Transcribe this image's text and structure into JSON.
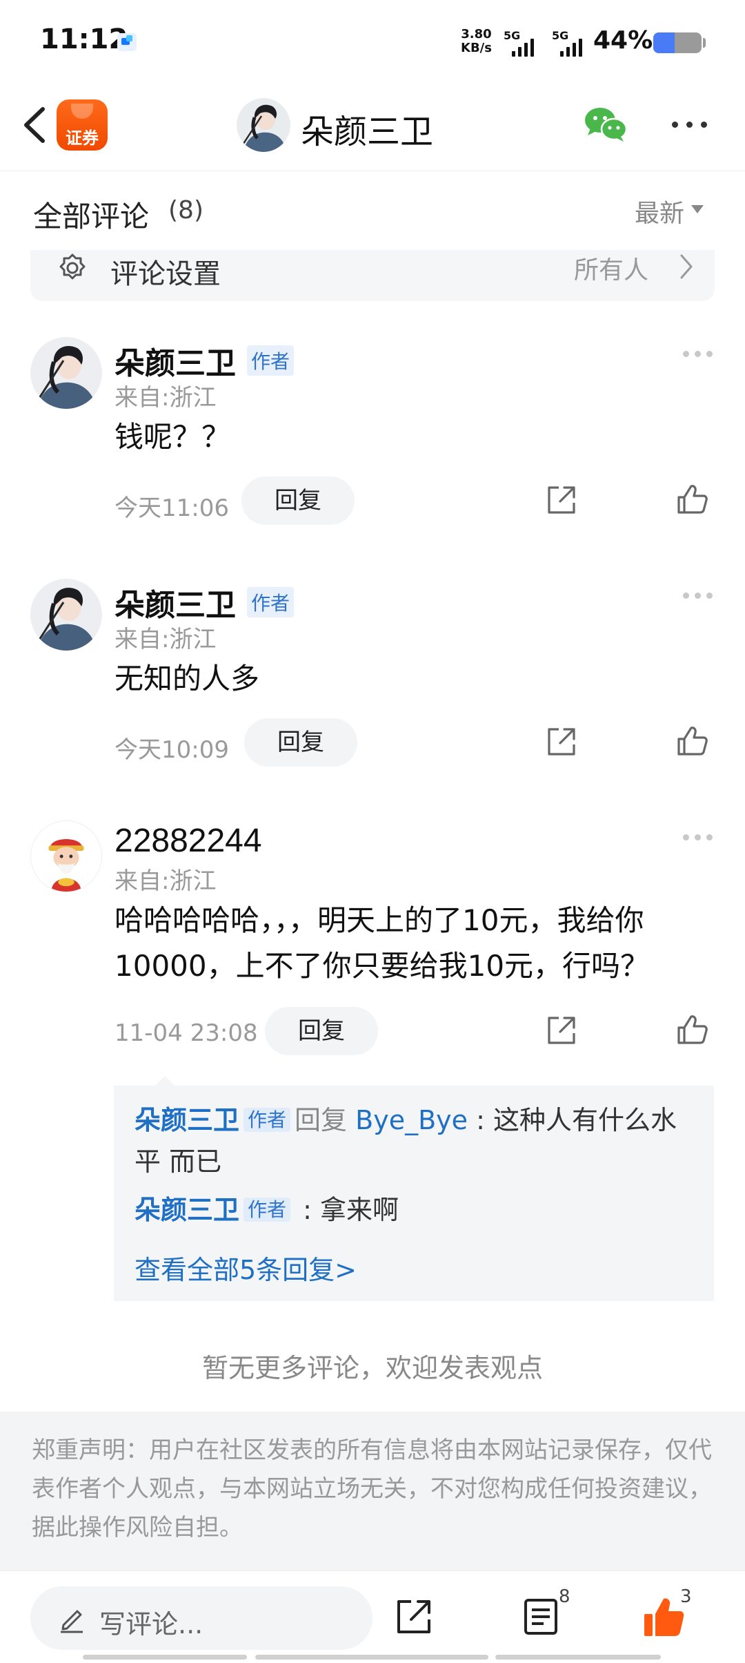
{
  "status_bar": {
    "time": "11:12",
    "speed_value": "3.80",
    "speed_unit": "KB/s",
    "network_1": "5G",
    "network_2": "5G",
    "battery": "44%",
    "battery_level": 0.44
  },
  "header": {
    "app_logo_text": "证券",
    "title": "朵颜三卫",
    "accent_color": "#ff5a0f"
  },
  "comments_section": {
    "title": "全部评论",
    "count": "(8)",
    "sort_label": "最新"
  },
  "settings_bar": {
    "label": "评论设置",
    "value": "所有人"
  },
  "comments": [
    {
      "name": "朵颜三卫",
      "badge": "作者",
      "from": "来自:浙江",
      "body": "钱呢？？",
      "time": "今天11:06",
      "reply_label": "回复"
    },
    {
      "name": "朵颜三卫",
      "badge": "作者",
      "from": "来自:浙江",
      "body": "无知的人多",
      "time": "今天10:09",
      "reply_label": "回复"
    },
    {
      "name": "22882244",
      "from": "来自:浙江",
      "body": "哈哈哈哈哈，，，明天上的了10元，我给你10000，上不了你只要给我10元，行吗？",
      "time": "11-04 23:08",
      "reply_label": "回复",
      "replies": [
        {
          "name": "朵颜三卫",
          "badge": "作者",
          "verb": "回复",
          "target": "Bye_Bye",
          "text": "这种人有什么水平 而已"
        },
        {
          "name": "朵颜三卫",
          "badge": "作者",
          "text": "拿来啊"
        }
      ],
      "view_all": "查看全部5条回复>"
    }
  ],
  "no_more_text": "暂无更多评论，欢迎发表观点",
  "disclaimer": "郑重声明：用户在社区发表的所有信息将由本网站记录保存，仅代表作者个人观点，与本网站立场无关，不对您构成任何投资建议，据此操作风险自担。",
  "bottom_bar": {
    "input_placeholder": "写评论...",
    "comment_count": "8",
    "like_count": "3"
  }
}
